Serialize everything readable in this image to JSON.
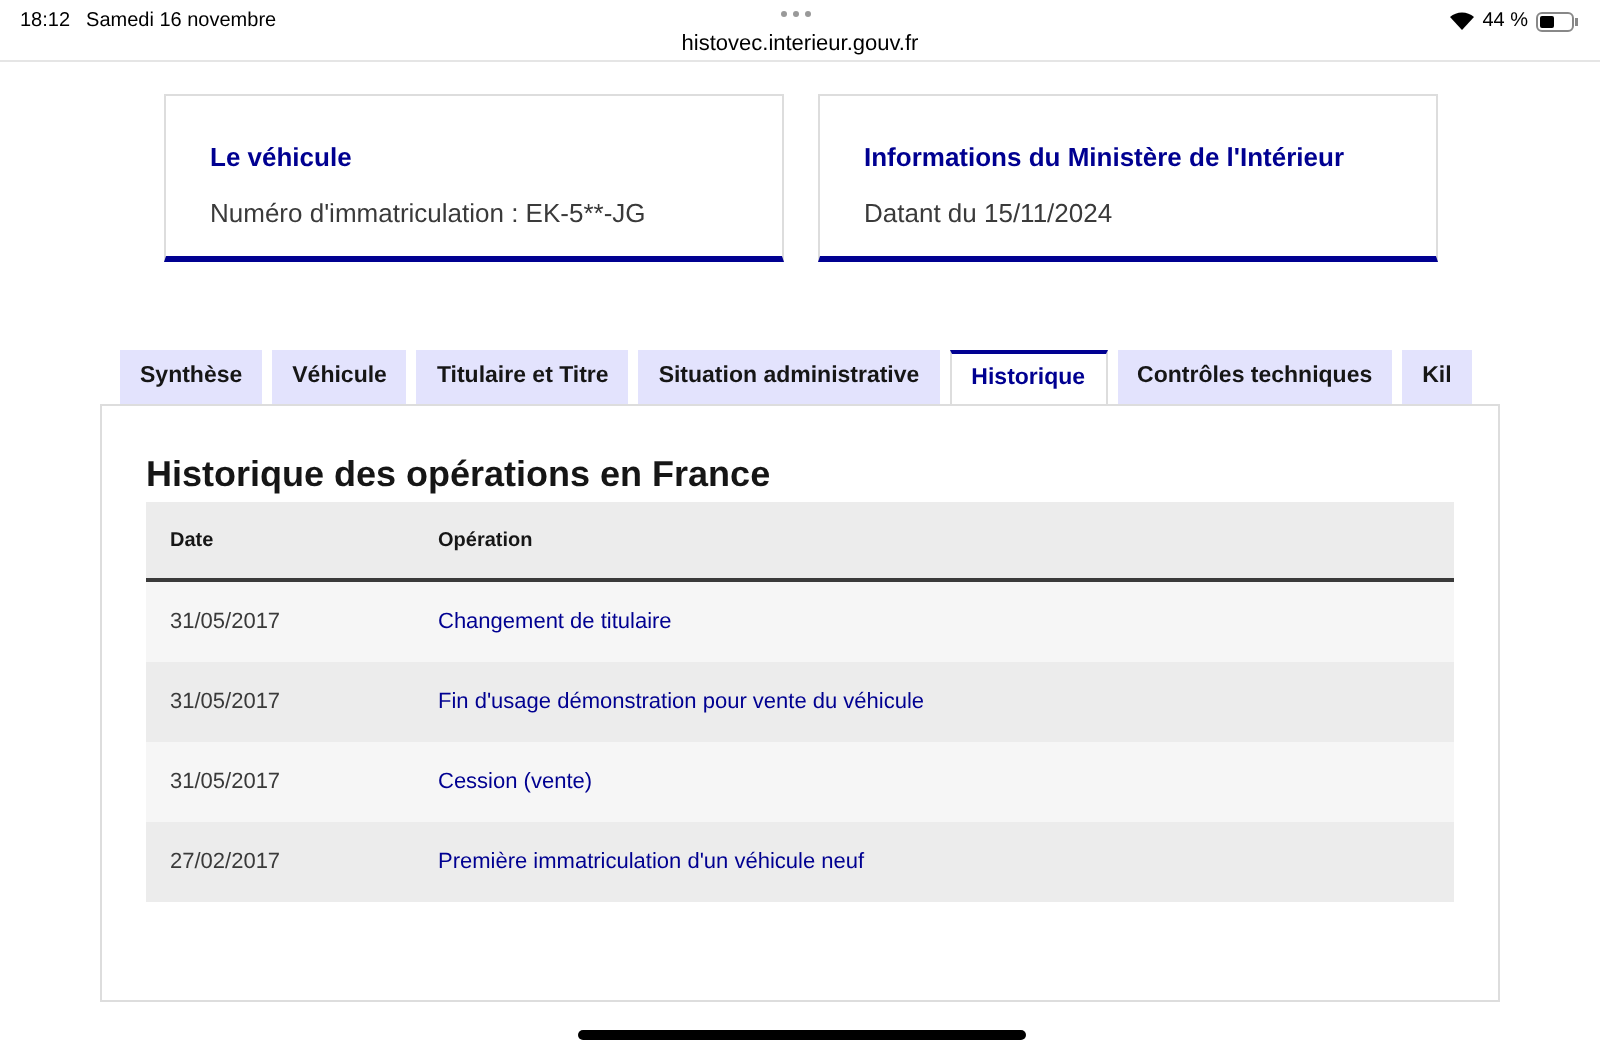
{
  "status_bar": {
    "time": "18:12",
    "date": "Samedi 16 novembre",
    "battery": "44 %"
  },
  "browser": {
    "url": "histovec.interieur.gouv.fr"
  },
  "cards": [
    {
      "title": "Le véhicule",
      "text": "Numéro d'immatriculation : EK-5**-JG"
    },
    {
      "title": "Informations du Ministère de l'Intérieur",
      "text": "Datant du 15/11/2024"
    }
  ],
  "tabs": [
    {
      "label": "Synthèse",
      "selected": false
    },
    {
      "label": "Véhicule",
      "selected": false
    },
    {
      "label": "Titulaire et Titre",
      "selected": false
    },
    {
      "label": "Situation administrative",
      "selected": false
    },
    {
      "label": "Historique",
      "selected": true
    },
    {
      "label": "Contrôles techniques",
      "selected": false
    },
    {
      "label": "Kil",
      "selected": false
    }
  ],
  "panel": {
    "title": "Historique des opérations en France",
    "table": {
      "columns": [
        "Date",
        "Opération"
      ],
      "rows": [
        {
          "date": "31/05/2017",
          "operation": "Changement de titulaire"
        },
        {
          "date": "31/05/2017",
          "operation": "Fin d'usage démonstration pour vente du véhicule"
        },
        {
          "date": "31/05/2017",
          "operation": "Cession (vente)"
        },
        {
          "date": "27/02/2017",
          "operation": "Première immatriculation d'un véhicule neuf"
        }
      ]
    }
  }
}
